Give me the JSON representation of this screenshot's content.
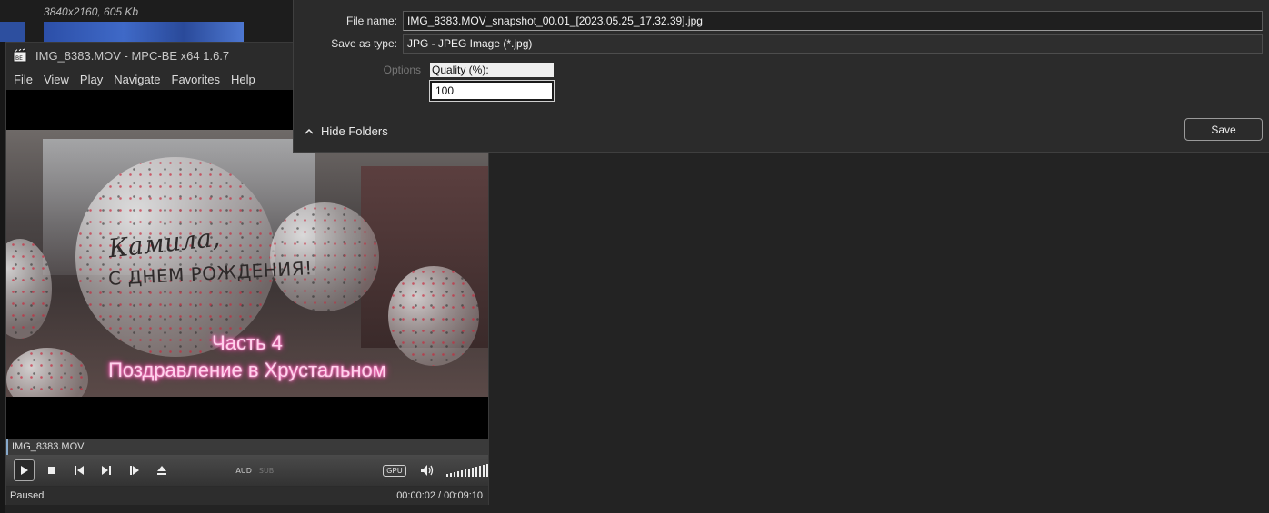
{
  "desktop": {
    "file_info": "3840x2160, 605 Kb"
  },
  "player": {
    "title": "IMG_8383.MOV - MPC-BE x64 1.6.7",
    "menu": [
      "File",
      "View",
      "Play",
      "Navigate",
      "Favorites",
      "Help"
    ],
    "video": {
      "balloon_line1": "Камила,",
      "balloon_line2": "С ДНЕМ РОЖДЕНИЯ!",
      "caption_line1": "Часть 4",
      "caption_line2": "Поздравление в Хрустальном"
    },
    "current_file": "IMG_8383.MOV",
    "controls": {
      "aud_label": "AUD",
      "sub_label": "SUB",
      "gpu_label": "GPU"
    },
    "status": {
      "state": "Paused",
      "time": "00:00:02 / 00:09:10"
    }
  },
  "dialog": {
    "file_name_label": "File name:",
    "file_name_value": "IMG_8383.MOV_snapshot_00.01_[2023.05.25_17.32.39].jpg",
    "save_type_label": "Save as type:",
    "save_type_value": "JPG - JPEG Image (*.jpg)",
    "options_label": "Options",
    "quality_label": "Quality (%):",
    "quality_value": "100",
    "hide_folders_label": "Hide Folders",
    "save_button": "Save"
  },
  "colors": {
    "caption_glow": "#ff3da7",
    "dialog_bg": "#2b2b2b",
    "player_bg": "#2b2b2b"
  }
}
